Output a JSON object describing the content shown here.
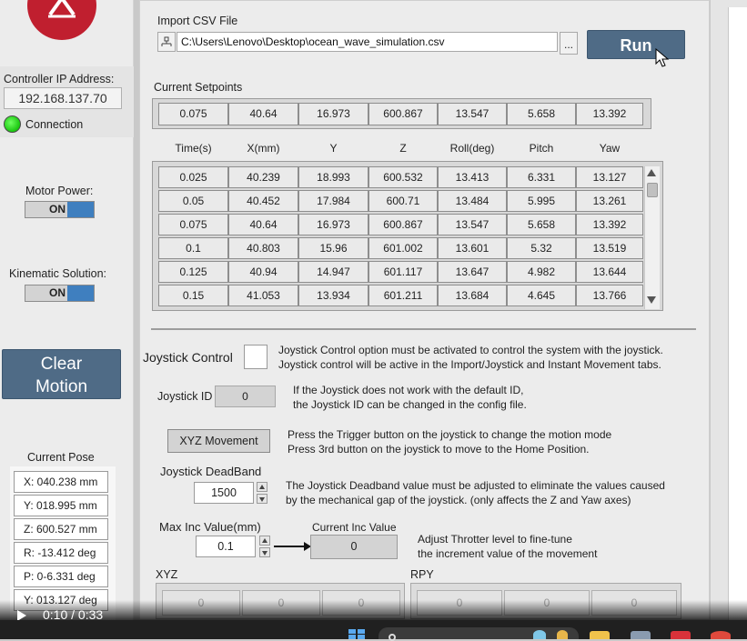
{
  "sidebar": {
    "controller_ip_label": "Controller IP Address:",
    "controller_ip": "192.168.137.70",
    "connection_label": "Connection",
    "motor_power_label": "Motor Power:",
    "motor_power_state": "ON",
    "kinematic_label": "Kinematic Solution:",
    "kinematic_state": "ON",
    "clear_motion_line1": "Clear",
    "clear_motion_line2": "Motion",
    "current_pose_label": "Current Pose",
    "pose": [
      "X: 040.238 mm",
      "Y: 018.995 mm",
      "Z: 600.527 mm",
      "R: -13.412 deg",
      "P: 0-6.331 deg",
      "Y: 013.127 deg"
    ]
  },
  "import": {
    "label": "Import CSV File",
    "path": "C:\\Users\\Lenovo\\Desktop\\ocean_wave_simulation.csv",
    "browse_label": "...",
    "run_label": "Run"
  },
  "setpoints": {
    "label": "Current Setpoints",
    "values": [
      "0.075",
      "40.64",
      "16.973",
      "600.867",
      "13.547",
      "5.658",
      "13.392"
    ]
  },
  "table": {
    "headers": [
      "Time(s)",
      "X(mm)",
      "Y",
      "Z",
      "Roll(deg)",
      "Pitch",
      "Yaw"
    ],
    "rows": [
      [
        "0.025",
        "40.239",
        "18.993",
        "600.532",
        "13.413",
        "6.331",
        "13.127"
      ],
      [
        "0.05",
        "40.452",
        "17.984",
        "600.71",
        "13.484",
        "5.995",
        "13.261"
      ],
      [
        "0.075",
        "40.64",
        "16.973",
        "600.867",
        "13.547",
        "5.658",
        "13.392"
      ],
      [
        "0.1",
        "40.803",
        "15.96",
        "601.002",
        "13.601",
        "5.32",
        "13.519"
      ],
      [
        "0.125",
        "40.94",
        "14.947",
        "601.117",
        "13.647",
        "4.982",
        "13.644"
      ],
      [
        "0.15",
        "41.053",
        "13.934",
        "601.211",
        "13.684",
        "4.645",
        "13.766"
      ]
    ]
  },
  "joystick": {
    "control_label": "Joystick Control",
    "control_desc1": "Joystick Control option must be activated to control the system with the joystick.",
    "control_desc2": "Joystick control will be active in the Import/Joystick and Instant Movement tabs.",
    "id_label": "Joystick ID",
    "id_value": "0",
    "id_desc1": "If the Joystick does not work with the default ID,",
    "id_desc2": "the Joystick ID can be changed in the config file.",
    "movement_button": "XYZ Movement",
    "movement_desc1": "Press the Trigger button on the joystick to change the motion mode",
    "movement_desc2": "Press 3rd button on the joystick to move to the Home Position.",
    "deadband_label": "Joystick DeadBand",
    "deadband_value": "1500",
    "deadband_desc1": "The Joystick Deadband value must be adjusted to eliminate the values caused",
    "deadband_desc2": "by the mechanical gap of the joystick. (only affects the Z and Yaw axes)",
    "max_inc_label": "Max Inc Value(mm)",
    "max_inc_value": "0.1",
    "current_inc_label": "Current Inc Value",
    "current_inc_value": "0",
    "inc_desc1": "Adjust Throtter level to fine-tune",
    "inc_desc2": "the increment value of the movement",
    "xyz_label": "XYZ",
    "xyz_values": [
      "0",
      "0",
      "0"
    ],
    "rpy_label": "RPY",
    "rpy_values": [
      "0",
      "0",
      "0"
    ]
  },
  "video": {
    "time": "0:10 / 0:33"
  },
  "colors": {
    "accent": "#4f6b86",
    "led_on": "#19c60f",
    "logo": "#c01f2f",
    "toggle_on": "#3f7fbf"
  }
}
